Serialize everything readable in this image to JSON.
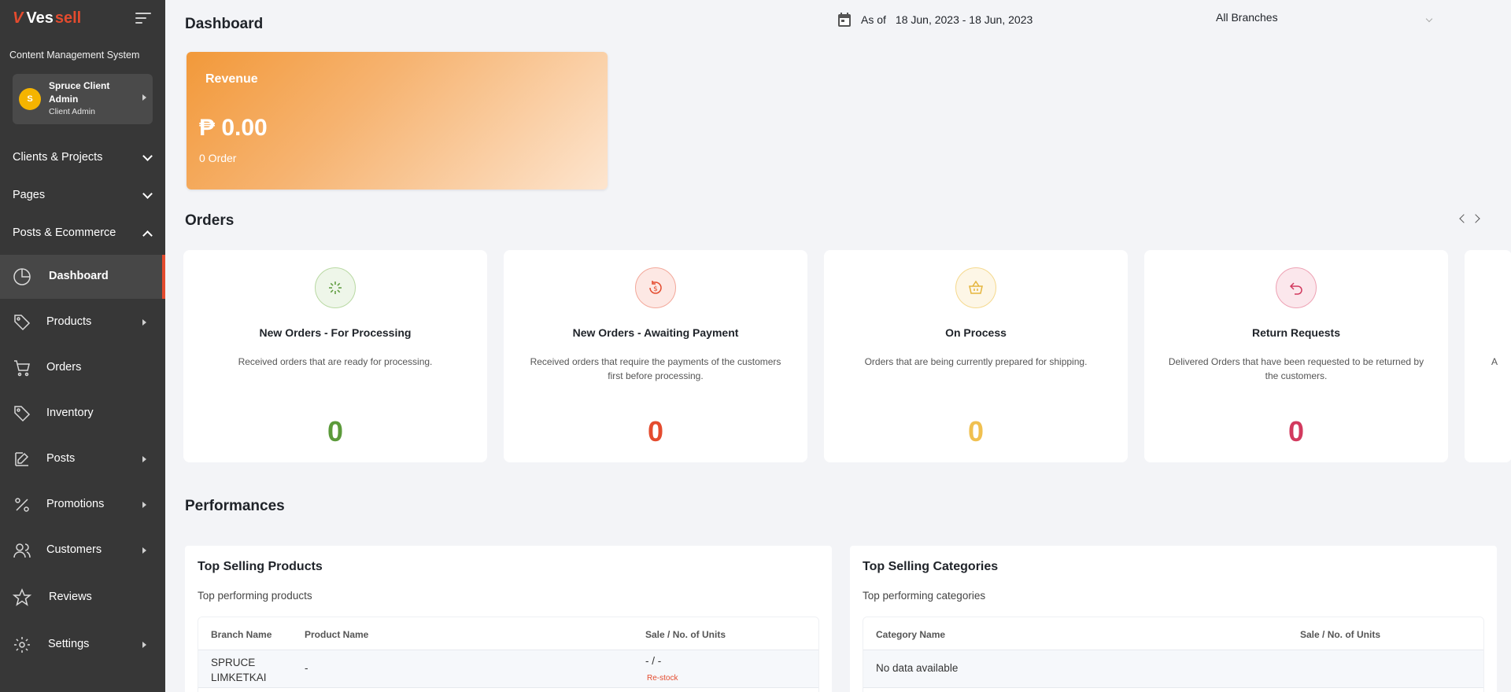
{
  "brand": {
    "mark": "V",
    "name_part1": "Ves",
    "name_part2": "sell"
  },
  "sidebar": {
    "cms_title": "Content Management System",
    "user": {
      "initial": "S",
      "name": "Spruce Client Admin",
      "role": "Client Admin"
    },
    "sections": [
      {
        "label": "Clients & Projects",
        "expanded": false
      },
      {
        "label": "Pages",
        "expanded": false
      },
      {
        "label": "Posts & Ecommerce",
        "expanded": true
      }
    ],
    "items": [
      {
        "label": "Dashboard",
        "icon": "pie-chart-icon",
        "active": true,
        "has_submenu": false
      },
      {
        "label": "Products",
        "icon": "tag-icon",
        "active": false,
        "has_submenu": true
      },
      {
        "label": "Orders",
        "icon": "cart-icon",
        "active": false,
        "has_submenu": false
      },
      {
        "label": "Inventory",
        "icon": "tag-icon",
        "active": false,
        "has_submenu": false
      },
      {
        "label": "Posts",
        "icon": "edit-icon",
        "active": false,
        "has_submenu": true
      },
      {
        "label": "Promotions",
        "icon": "percent-icon",
        "active": false,
        "has_submenu": true
      },
      {
        "label": "Customers",
        "icon": "users-icon",
        "active": false,
        "has_submenu": true
      },
      {
        "label": "Reviews",
        "icon": "star-icon",
        "active": false,
        "has_submenu": false
      },
      {
        "label": "Settings",
        "icon": "gear-icon",
        "active": false,
        "has_submenu": true
      }
    ]
  },
  "header": {
    "title": "Dashboard",
    "date_prefix": "As of",
    "date_range": "18 Jun, 2023 - 18 Jun, 2023",
    "branch": "All Branches"
  },
  "revenue": {
    "title": "Revenue",
    "amount": "₱ 0.00",
    "orders": "0 Order"
  },
  "orders": {
    "title": "Orders",
    "cards": [
      {
        "title": "New Orders - For Processing",
        "desc": "Received orders that are ready for processing.",
        "count": "0",
        "color": "#5b9a3a",
        "icon": "spinner-icon"
      },
      {
        "title": "New Orders - Awaiting Payment",
        "desc": "Received orders that require the payments of the customers first before processing.",
        "count": "0",
        "color": "#e44b2e",
        "icon": "payment-icon"
      },
      {
        "title": "On Process",
        "desc": "Orders that are being currently prepared for shipping.",
        "count": "0",
        "color": "#f0c050",
        "icon": "basket-icon"
      },
      {
        "title": "Return Requests",
        "desc": "Delivered Orders that have been requested to be returned by the customers.",
        "count": "0",
        "color": "#d23a5e",
        "icon": "return-icon"
      }
    ],
    "partial_card_desc": "A"
  },
  "performances": {
    "title": "Performances",
    "top_products": {
      "title": "Top Selling Products",
      "subtitle": "Top performing products",
      "columns": [
        "Branch Name",
        "Product Name",
        "Sale / No. of Units"
      ],
      "rows": [
        {
          "branch": "SPRUCE LIMKETKAI",
          "product": "-",
          "sale": "- / -",
          "action": "Re-stock"
        }
      ]
    },
    "top_categories": {
      "title": "Top Selling Categories",
      "subtitle": "Top performing categories",
      "columns": [
        "Category Name",
        "Sale / No. of Units"
      ],
      "empty": "No data available"
    }
  },
  "colors": {
    "accent": "#e44b2e",
    "sidebar_bg": "#373737",
    "page_bg": "#f3f4f7"
  }
}
